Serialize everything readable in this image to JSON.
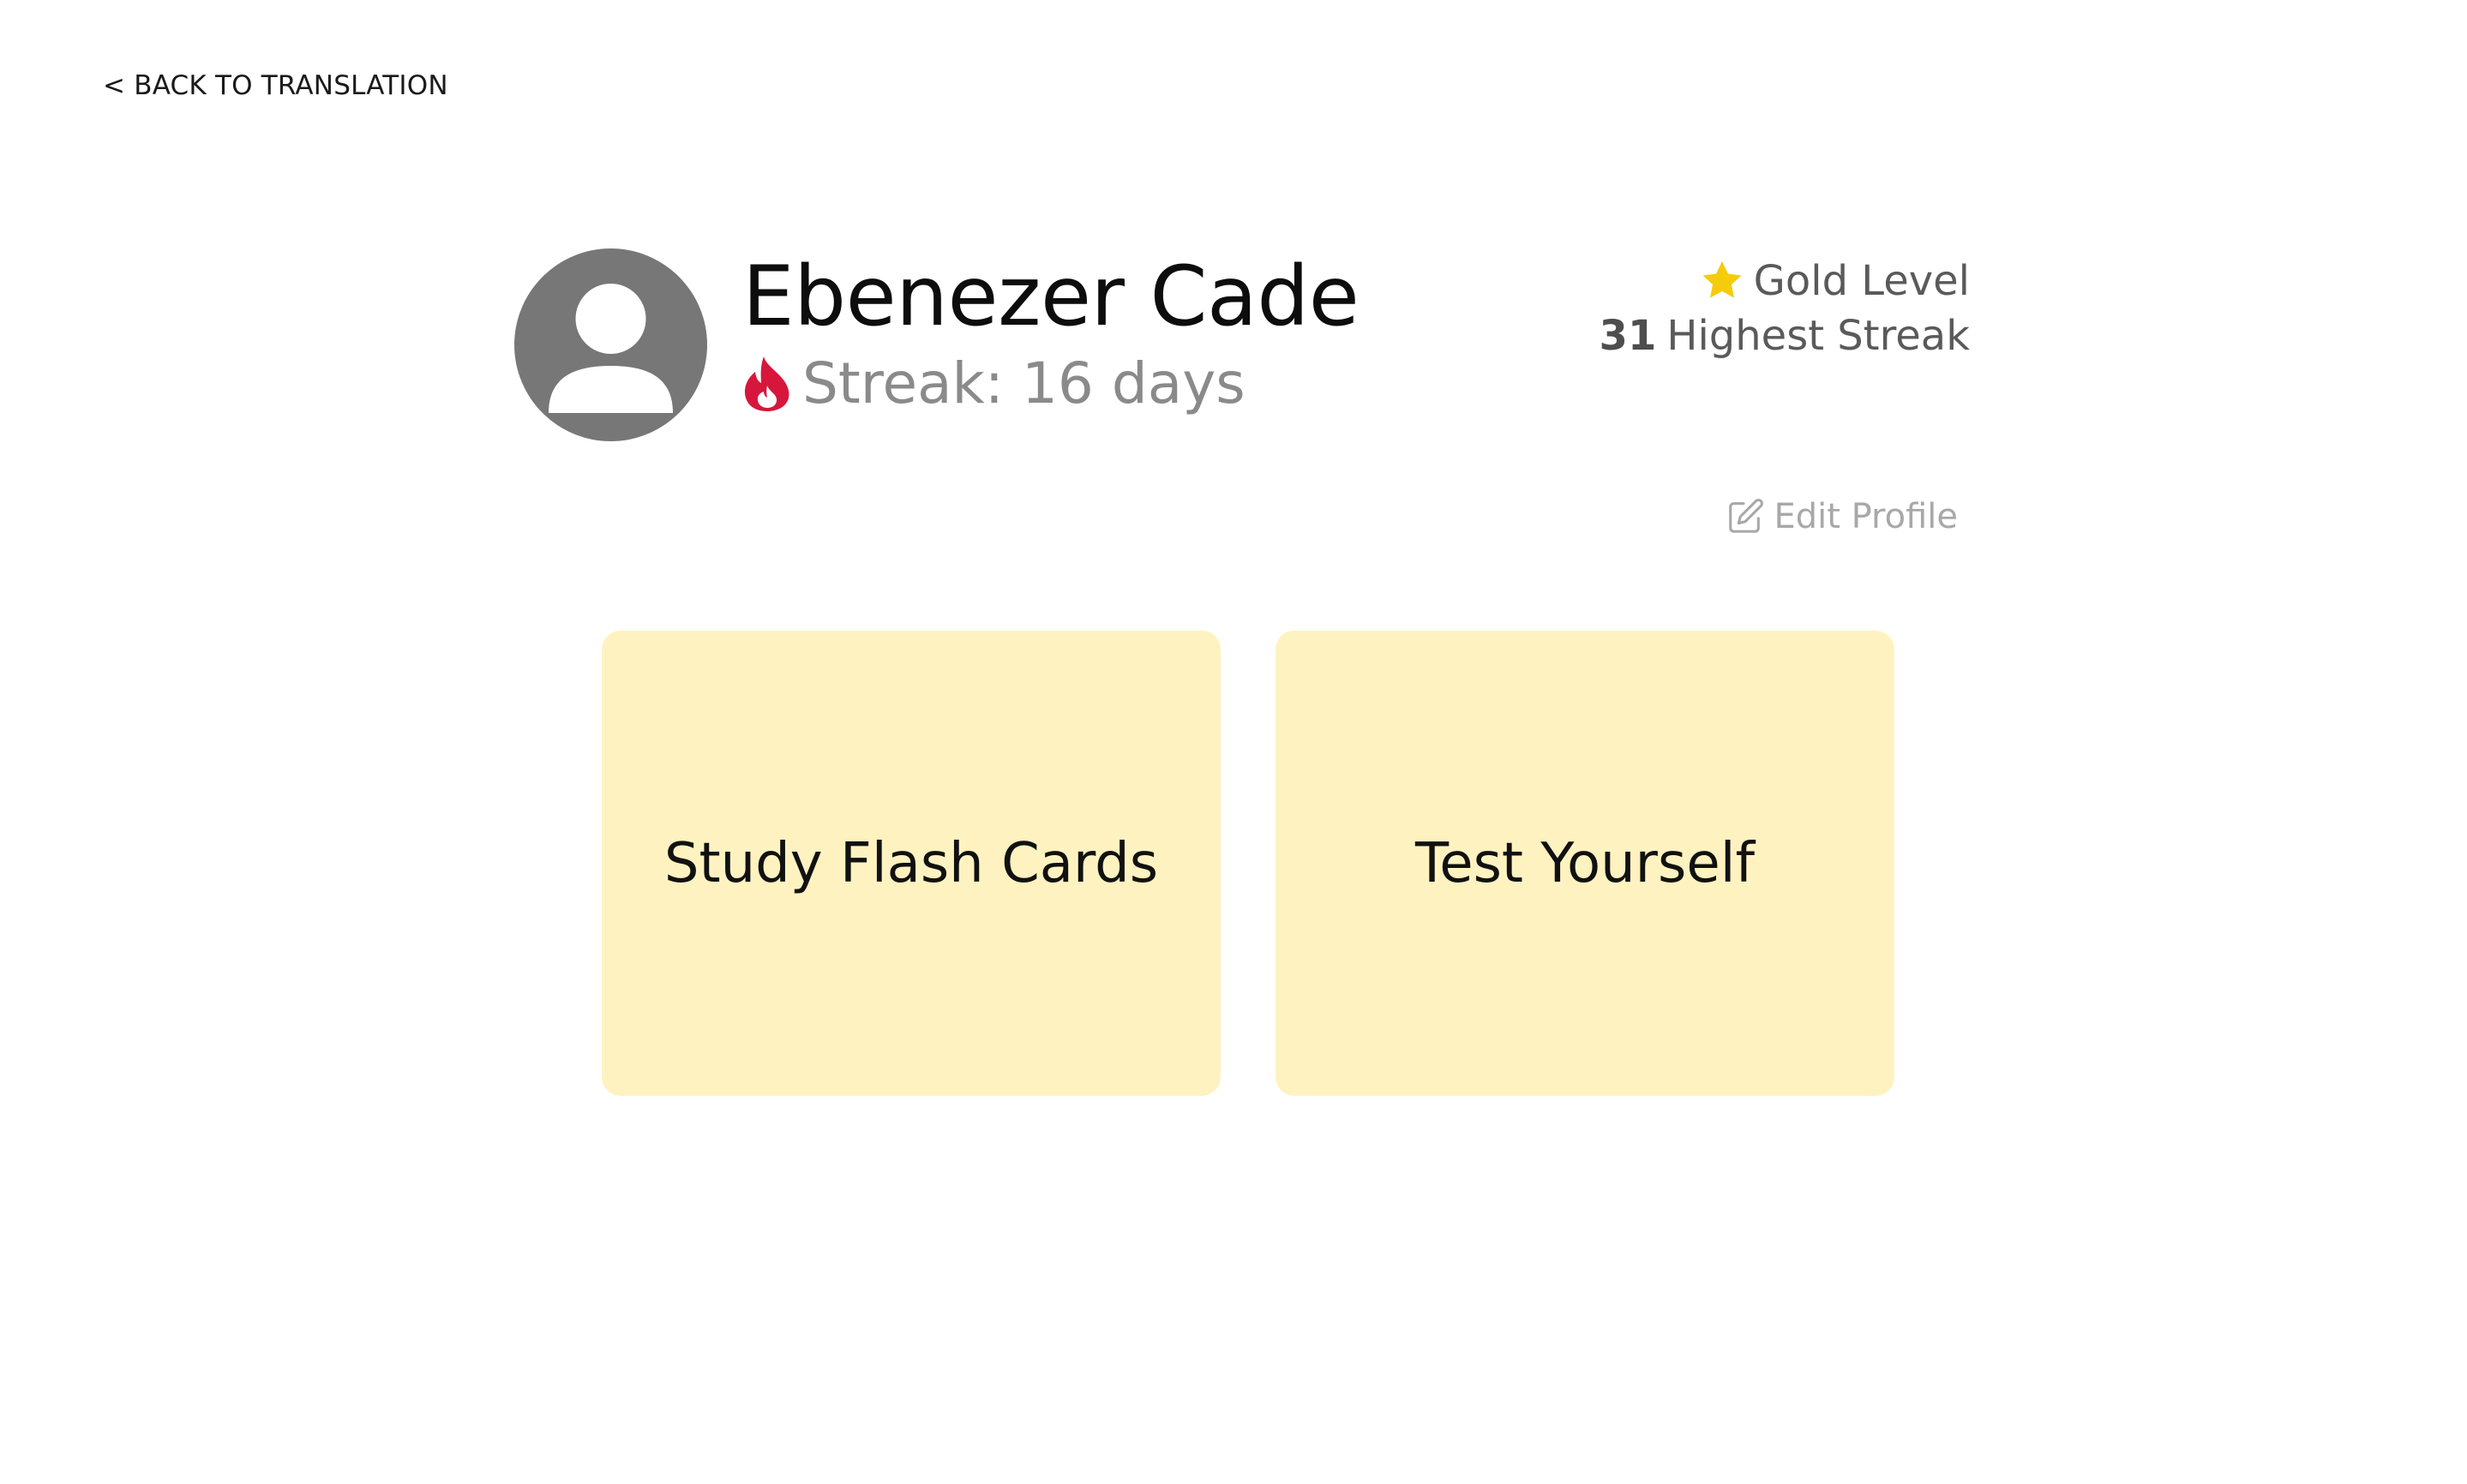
{
  "nav": {
    "back_label": "< BACK TO TRANSLATION"
  },
  "profile": {
    "name": "Ebenezer Cade",
    "streak_text": "Streak: 16 days",
    "level_label": "Gold Level",
    "highest_streak_value": "31",
    "highest_streak_label": "Highest Streak",
    "edit_label": "Edit Profile"
  },
  "cards": {
    "study_label": "Study Flash Cards",
    "test_label": "Test Yourself"
  },
  "colors": {
    "card_background": "#fef3c0",
    "flame": "#d7163c",
    "star": "#f5cc0c",
    "avatar": "#777777"
  },
  "icons": {
    "avatar": "user-avatar-icon",
    "streak": "flame-icon",
    "level": "star-icon",
    "edit": "edit-icon"
  }
}
